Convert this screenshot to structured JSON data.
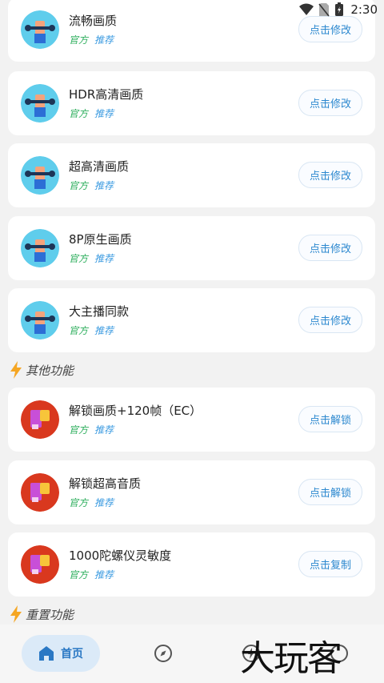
{
  "status_bar": {
    "time": "2:30"
  },
  "quality_items": [
    {
      "title": "流畅画质",
      "tag_official": "官方",
      "tag_recommend": "推荐",
      "action": "点击修改"
    },
    {
      "title": "HDR高清画质",
      "tag_official": "官方",
      "tag_recommend": "推荐",
      "action": "点击修改"
    },
    {
      "title": "超高清画质",
      "tag_official": "官方",
      "tag_recommend": "推荐",
      "action": "点击修改"
    },
    {
      "title": "8P原生画质",
      "tag_official": "官方",
      "tag_recommend": "推荐",
      "action": "点击修改"
    },
    {
      "title": "大主播同款",
      "tag_official": "官方",
      "tag_recommend": "推荐",
      "action": "点击修改"
    }
  ],
  "section_other": {
    "label": "其他功能"
  },
  "other_items": [
    {
      "title": "解锁画质+120帧（EC）",
      "tag_official": "官方",
      "tag_recommend": "推荐",
      "action": "点击解锁"
    },
    {
      "title": "解锁超高音质",
      "tag_official": "官方",
      "tag_recommend": "推荐",
      "action": "点击解锁"
    },
    {
      "title": "1000陀螺仪灵敏度",
      "tag_official": "官方",
      "tag_recommend": "推荐",
      "action": "点击复制"
    }
  ],
  "section_reset": {
    "label": "重置功能"
  },
  "bottom_nav": {
    "home_label": "首页"
  },
  "watermark": "大玩客",
  "colors": {
    "accent_blue": "#2c88cf",
    "tag_green": "#2cae5c",
    "bolt_orange": "#f5a623"
  }
}
